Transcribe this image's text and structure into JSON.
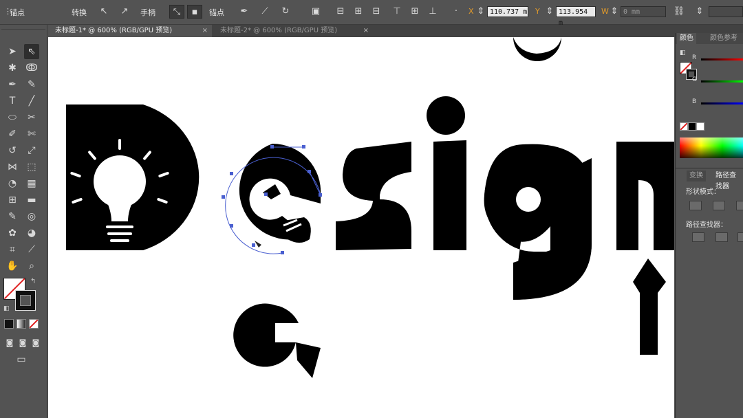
{
  "control_bar": {
    "anchor_label": "锚点",
    "convert_label": "转换",
    "handles_label": "手柄",
    "anchors_label": "锚点",
    "x_value": "110.737 m",
    "y_value": "113.954 m",
    "w_value": "0 mm",
    "x_prefix": "X",
    "y_prefix": "Y",
    "w_prefix": "W"
  },
  "tabs": [
    {
      "label": "未标题-1* @ 600% (RGB/GPU 预览)",
      "close": "×"
    },
    {
      "label": "未标题-2* @ 600% (RGB/GPU 预览)",
      "close": "×"
    }
  ],
  "panel": {
    "tab_color": "颜色",
    "tab_color_ref": "颜色参考",
    "r_label": "R",
    "g_label": "G",
    "b_label": "B",
    "tab_transform": "变换",
    "tab_pathfinder": "路径查找器",
    "shape_modes_label": "形状模式：",
    "pathfinders_label": "路径查找器："
  },
  "colors": {
    "ui_bg": "#535353",
    "canvas": "#ffffff",
    "art": "#000000",
    "selection": "#4a5fd0"
  }
}
